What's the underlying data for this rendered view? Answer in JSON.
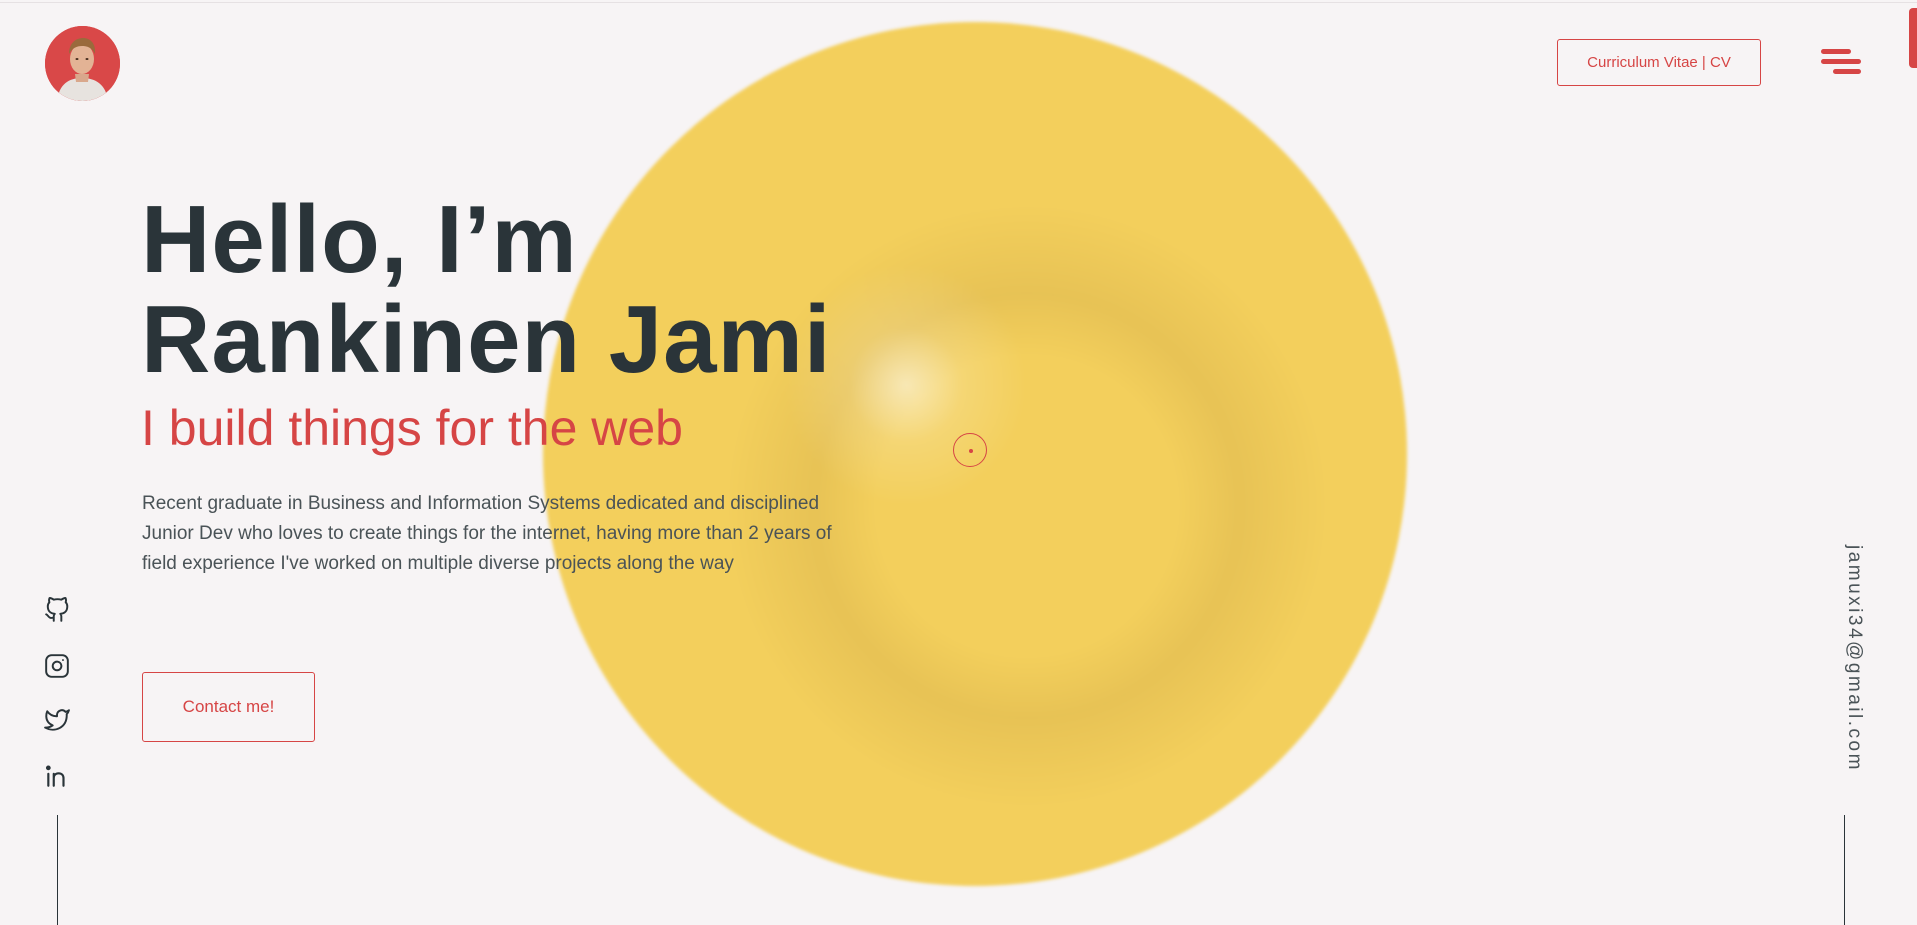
{
  "header": {
    "cv_label": "Curriculum Vitae | CV",
    "menu_icon": "menu-icon",
    "avatar_icon": "avatar"
  },
  "hero": {
    "title_line1": "Hello, I’m",
    "title_line2": "Rankinen Jami",
    "subtitle": "I build things for the web",
    "description": "Recent graduate in Business and Information Systems dedicated and disciplined Junior Dev who loves to create things for the internet, having more than 2 years of field experience I've worked on multiple diverse projects along the way",
    "contact_label": "Contact me!"
  },
  "social": {
    "items": [
      "github-icon",
      "instagram-icon",
      "twitter-icon",
      "linkedin-icon"
    ]
  },
  "email": "jamuxi34@gmail.com",
  "colors": {
    "accent": "#d64545",
    "text_dark": "#2a3439",
    "blob": "#f3cf5c",
    "background": "#f7f4f5"
  }
}
